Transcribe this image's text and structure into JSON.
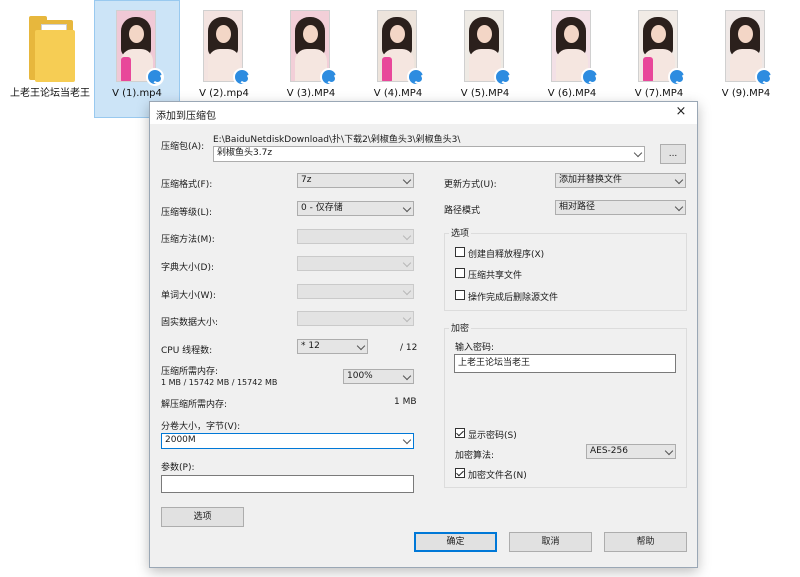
{
  "explorer": {
    "folder": {
      "label": "上老王论坛当老王"
    },
    "files": [
      {
        "label": "V (1).mp4",
        "selected": true,
        "bg": "#f0c9d6"
      },
      {
        "label": "V (2).mp4",
        "selected": false,
        "bg": "#f3e3e0"
      },
      {
        "label": "V (3).MP4",
        "selected": false,
        "bg": "#f2cfd8"
      },
      {
        "label": "V (4).MP4",
        "selected": false,
        "bg": "#ede4dc"
      },
      {
        "label": "V (5).MP4",
        "selected": false,
        "bg": "#eeeae4"
      },
      {
        "label": "V (6).MP4",
        "selected": false,
        "bg": "#f3e0e6"
      },
      {
        "label": "V (7).MP4",
        "selected": false,
        "bg": "#f1ebe6"
      },
      {
        "label": "V (9).MP4",
        "selected": false,
        "bg": "#efe8e6"
      }
    ]
  },
  "dialog": {
    "title": "添加到压缩包",
    "close": "×",
    "archive_label": "压缩包(A):",
    "archive_path": "E:\\BaiduNetdiskDownload\\扑\\下载2\\剁椒鱼头3\\剁椒鱼头3\\",
    "archive_name": "剁椒鱼头3.7z",
    "browse_label": "...",
    "format_label": "压缩格式(F):",
    "format_value": "7z",
    "level_label": "压缩等级(L):",
    "level_value": "0 - 仅存储",
    "method_label": "压缩方法(M):",
    "dict_label": "字典大小(D):",
    "word_label": "单词大小(W):",
    "solid_label": "固实数据大小:",
    "cpu_label": "CPU 线程数:",
    "cpu_value": "* 12",
    "cpu_total": "/ 12",
    "mem_comp_label": "压缩所需内存:",
    "mem_comp_value": "1 MB / 15742 MB / 15742 MB",
    "mem_percent": "100%",
    "mem_decomp_label": "解压缩所需内存:",
    "mem_decomp_value": "1 MB",
    "volume_label": "分卷大小，字节(V):",
    "volume_value": "2000M",
    "params_label": "参数(P):",
    "params_value": "",
    "options_button": "选项",
    "update_label": "更新方式(U):",
    "update_value": "添加并替换文件",
    "path_label": "路径模式",
    "path_value": "相对路径",
    "options_group": "选项",
    "opt_sfx": "创建自释放程序(X)",
    "opt_shared": "压缩共享文件",
    "opt_delete": "操作完成后删除源文件",
    "encrypt_group": "加密",
    "password_label": "输入密码:",
    "password_value": "上老王论坛当老王",
    "show_password": "显示密码(S)",
    "algo_label": "加密算法:",
    "algo_value": "AES-256",
    "encrypt_names": "加密文件名(N)",
    "ok": "确定",
    "cancel": "取消",
    "help": "帮助"
  }
}
